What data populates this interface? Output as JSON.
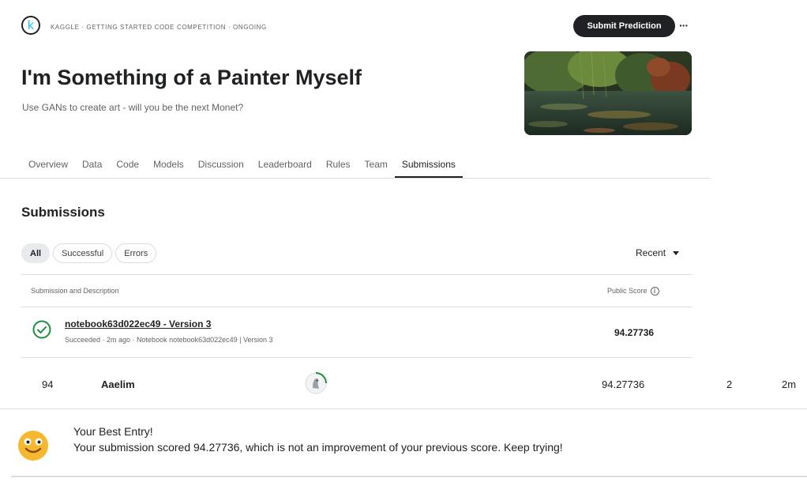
{
  "header": {
    "logo_letter": "k",
    "meta": "KAGGLE · GETTING STARTED CODE COMPETITION · ONGOING",
    "submit_label": "Submit Prediction",
    "more_label": "···"
  },
  "competition": {
    "title": "I'm Something of a Painter Myself",
    "subtitle": "Use GANs to create art - will you be the next Monet?"
  },
  "tabs": [
    "Overview",
    "Data",
    "Code",
    "Models",
    "Discussion",
    "Leaderboard",
    "Rules",
    "Team",
    "Submissions"
  ],
  "active_tab": "Submissions",
  "submissions": {
    "title": "Submissions",
    "filters": [
      "All",
      "Successful",
      "Errors"
    ],
    "selected_filter": "All",
    "sort_label": "Recent",
    "columns": {
      "description": "Submission and Description",
      "score": "Public Score",
      "info_icon": "i"
    },
    "rows": [
      {
        "name": "notebook63d022ec49 - Version 3",
        "meta": "Succeeded · 2m ago · Notebook notebook63d022ec49 | Version 3",
        "score": "94.27736",
        "status_icon": "check-circle-icon"
      }
    ]
  },
  "leaderboard_row": {
    "rank": "94",
    "team": "Aaelim",
    "score": "94.27736",
    "entries": "2",
    "last": "2m"
  },
  "toast": {
    "title": "Your Best Entry!",
    "message": "Your submission scored 94.27736, which is not an improvement of your previous score. Keep trying!",
    "icon": "smiley-icon"
  },
  "colors": {
    "primary": "#202124",
    "secondary_text": "#5f6368",
    "success": "#1e8e3e",
    "divider": "#dadce0",
    "toast_emoji": "#f5b82e"
  }
}
